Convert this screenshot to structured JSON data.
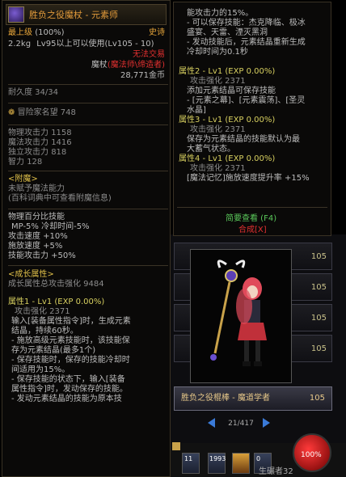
{
  "left_tooltip": {
    "item_name": "胜负之役魔杖 - 元素师",
    "grade": "最上级",
    "grade_pct": "(100%)",
    "rarity": "史诗",
    "weight": "2.2kg",
    "level_req": "Lv95以上可以使用(Lv105 - 10)",
    "trade_status": "无法交易",
    "item_type": "魔杖",
    "class_req": "(魔法师\\缔造者)",
    "price": "28,771金币",
    "durability": "耐久度 34/34",
    "adventurer_fame_label": "冒险家名望",
    "adventurer_fame_value": "748",
    "stats": [
      {
        "label": "物理攻击力",
        "value": "1158"
      },
      {
        "label": "魔法攻击力",
        "value": "1416"
      },
      {
        "label": "独立攻击力",
        "value": "818"
      },
      {
        "label": "智力",
        "value": "128"
      }
    ],
    "enchant_header": "<附魔>",
    "enchant_none": "未赋予魔法能力",
    "enchant_hint": "(百科词典中可查看附魔信息)",
    "extra_lines": [
      "物理百分比技能",
      "MP-5% 冷却时间-5%",
      "攻击速度 +10%",
      "施放速度 +5%",
      "技能攻击力 +50%"
    ],
    "growth_header": "<成长属性>",
    "growth_total": "成长属性总攻击强化 9484",
    "attr1_header": "属性1 - Lv1 (EXP 0.00%)",
    "attr1_lines": [
      "攻击强化 2371",
      "输入[装备属性指令]时，生成元素",
      "结晶，持续60秒。",
      "- 施放高级元素技能时，该技能保",
      "存为元素结晶(最多1个)",
      "- 保存技能时，保存的技能冷却时",
      "间适用为15%。",
      "- 保存技能的状态下，输入[装备",
      "属性指令]时，发动保存的技能。",
      "- 发动元素结晶的技能为原本技"
    ]
  },
  "right_tooltip": {
    "lines_top": [
      "能攻击力的15%。",
      "- 可以保存技能：杰克降临、极冰",
      "盛宴、天雷、湮灭黑洞",
      "- 发动技能后，元素结晶重新生成",
      "冷却时间为0.1秒"
    ],
    "attr2_header": "属性2 - Lv1 (EXP 0.00%)",
    "attr2_lines": [
      "攻击强化 2371",
      "添加元素结晶可保存技能",
      "- [元素之幕]、[元素震荡]、[圣灵",
      "水晶]"
    ],
    "attr3_header": "属性3 - Lv1 (EXP 0.00%)",
    "attr3_lines": [
      "攻击强化 2371",
      "保存为元素结晶的技能默认为最",
      "大蓄气状态。"
    ],
    "attr4_header": "属性4 - Lv1 (EXP 0.00%)",
    "attr4_lines": [
      "攻击强化 2371",
      "[魔法记忆]施放速度提升率 +15%"
    ],
    "brief_view": "简要查看 (F4)",
    "compose": "合成[X]"
  },
  "list_panel": {
    "slot_numbers": [
      "105",
      "105",
      "105",
      "105"
    ],
    "selected_item_name": "胜负之役棍棒 - 魔道学者",
    "selected_item_level": "105",
    "page_indicator": "21/417",
    "hp_percent": "100%",
    "bottom_text": "生碾者32",
    "hotkey_labels": [
      "11",
      "1993",
      "0"
    ]
  }
}
